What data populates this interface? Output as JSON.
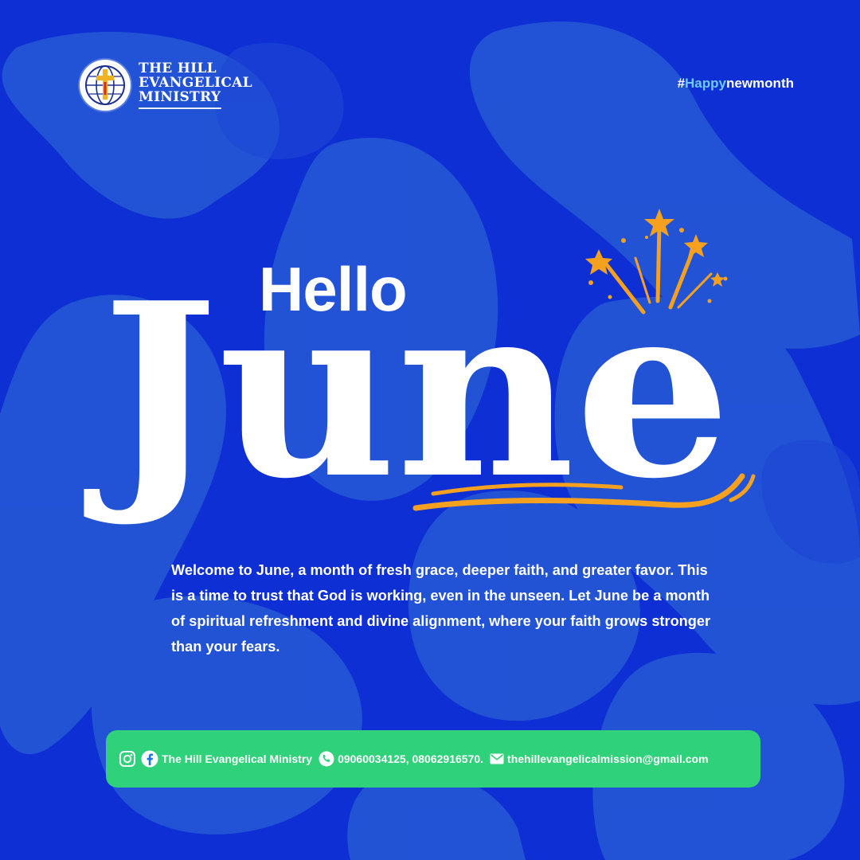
{
  "brand": {
    "name_lines": [
      "THE HILL",
      "EVANGELICAL",
      "MINISTRY"
    ],
    "emblem_icon": "globe-cross-icon"
  },
  "hashtag": {
    "prefix": "#",
    "accent": "Happy",
    "rest": "newmonth"
  },
  "headline": {
    "hello": "Hello",
    "month": "June"
  },
  "message": "Welcome to June, a month of fresh grace, deeper faith, and greater favor. This is a time to trust that God is working, even in the unseen. Let June be a month of spiritual refreshment and divine alignment, where your faith grows stronger than your fears.",
  "contact": {
    "social_icons": [
      "instagram-icon",
      "facebook-icon"
    ],
    "social_name": "The Hill Evangelical Ministry",
    "phone_icon": "phone-icon",
    "phones": "09060034125, 08062916570.",
    "email_icon": "mail-icon",
    "email": "thehillevangelicalmission@gmail.com"
  },
  "colors": {
    "background": "#0d2fd4",
    "blob_light": "#2a63d8",
    "accent_orange": "#f5a11f",
    "contact_green": "#2fd17a",
    "hashtag_accent": "#6fc9ff"
  }
}
